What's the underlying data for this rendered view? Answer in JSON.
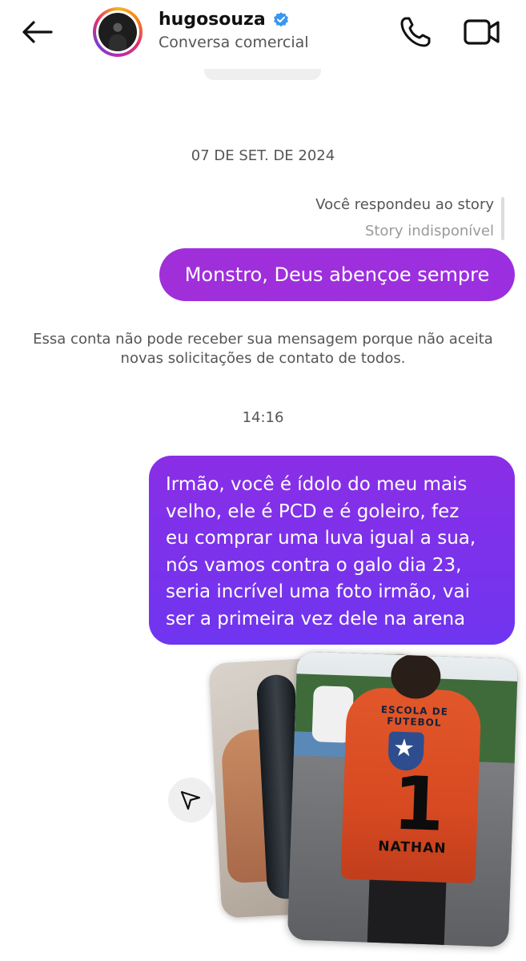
{
  "header": {
    "back_icon": "arrow-left-icon",
    "username": "hugosouza",
    "verified_icon": "verified-badge-icon",
    "verified_color": "#3897f0",
    "subtitle": "Conversa comercial",
    "call_icon": "phone-icon",
    "video_icon": "video-camera-icon"
  },
  "thread": {
    "date_separator": "07 DE SET. DE 2024",
    "story_reply": {
      "label": "Você respondeu ao story",
      "status": "Story indisponível"
    },
    "message_1": "Monstro, Deus abençoe sempre",
    "notice": "Essa conta não pode receber sua mensagem porque não aceita novas solicitações de contato de todos.",
    "time_separator": "14:16",
    "message_2_lines": [
      "Irmão, você é ídolo do meu mais",
      "velho, ele é PCD e é goleiro, fez",
      "eu comprar uma luva igual a sua,",
      "nós vamos contra o galo dia 23,",
      "seria incrível uma foto irmão, vai",
      "ser a primeira vez dele na arena"
    ],
    "share_icon": "send-paper-plane-icon",
    "photo_jersey_crest_text": "ESCOLA DE FUTEBOL",
    "photo_jersey_number": "1",
    "photo_jersey_name": "NATHAN"
  },
  "colors": {
    "bubble_1": "#a02fd9",
    "bubble_2_top": "#8a2ee6",
    "bubble_2_bottom": "#6f35f0"
  }
}
